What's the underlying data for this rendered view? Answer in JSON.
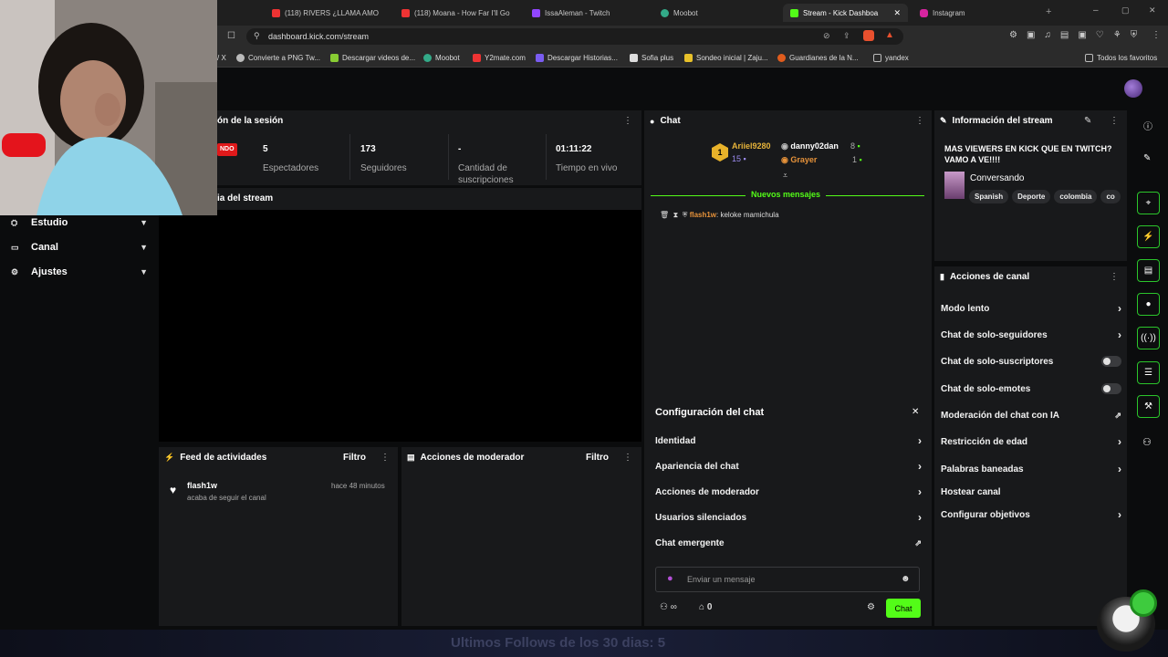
{
  "browser": {
    "tabs": [
      {
        "label": "(118) RIVERS ¿LLAMA AMO",
        "color": "#e33"
      },
      {
        "label": "(118) Moana - How Far I'll Go",
        "color": "#e33"
      },
      {
        "label": "IssaAleman - Twitch",
        "color": "#9146ff"
      },
      {
        "label": "Moobot",
        "color": "#3a8"
      },
      {
        "label": "Stream - Kick Dashboa",
        "color": "#53fc18"
      },
      {
        "label": "Instagram",
        "color": "#d6249f"
      }
    ],
    "url": "dashboard.kick.com/stream",
    "bookmarks": [
      {
        "label": "/ X",
        "color": "#999"
      },
      {
        "label": "Convierte a PNG Tw...",
        "color": "#bbb"
      },
      {
        "label": "Descargar videos de...",
        "color": "#8c3"
      },
      {
        "label": "Moobot",
        "color": "#3a8"
      },
      {
        "label": "Y2mate.com",
        "color": "#e33"
      },
      {
        "label": "Descargar Historias...",
        "color": "#7a5cf0"
      },
      {
        "label": "Sofia plus",
        "color": "#ddd"
      },
      {
        "label": "Sondeo inicial | Zaju...",
        "color": "#e8c12a"
      },
      {
        "label": "Guardianes de la N...",
        "color": "#e05c1d"
      },
      {
        "label": "yandex",
        "color": "#999"
      }
    ],
    "all_favorites": "Todos los favoritos"
  },
  "sidebar": {
    "items": [
      {
        "label": "Estudio",
        "icon": "studio-icon"
      },
      {
        "label": "Canal",
        "icon": "channel-icon"
      },
      {
        "label": "Ajustes",
        "icon": "settings-icon"
      }
    ]
  },
  "session": {
    "title": "ón de la sesión",
    "live_badge": "NDO",
    "stats": [
      {
        "value": "5",
        "label": "Espectadores"
      },
      {
        "value": "173",
        "label": "Seguidores"
      },
      {
        "value": "-",
        "label": "Cantidad de suscripciones"
      },
      {
        "value": "01:11:22",
        "label": "Tiempo en vivo"
      }
    ]
  },
  "preview": {
    "title": "ia del stream"
  },
  "activity": {
    "title": "Feed de actividades",
    "filter": "Filtro",
    "items": [
      {
        "user": "flash1w",
        "text": "acaba de seguir el canal",
        "time": "hace 48 minutos"
      }
    ]
  },
  "modactions": {
    "title": "Acciones de moderador",
    "filter": "Filtro"
  },
  "chat": {
    "title": "Chat",
    "top_gifters": [
      {
        "name": "Ariiel9280",
        "count": "15"
      },
      {
        "name": "danny02dan",
        "count": "8"
      },
      {
        "name": "Grayer",
        "count": "1"
      }
    ],
    "new_messages": "Nuevos mensajes",
    "messages": [
      {
        "user": "flash1w",
        "text": "keloke mamichula"
      }
    ],
    "settings": {
      "title": "Configuración del chat",
      "items": [
        "Identidad",
        "Apariencia del chat",
        "Acciones de moderador",
        "Usuarios silenciados",
        "Chat emergente"
      ]
    },
    "input_placeholder": "Enviar un mensaje",
    "points": "0",
    "send_label": "Chat"
  },
  "stream_info": {
    "title": "Información del stream",
    "stream_title": "MAS VIEWERS EN KICK QUE EN TWITCH? VAMO A VE!!!!",
    "category": "Conversando",
    "tags": [
      "Spanish",
      "Deporte",
      "colombia",
      "co"
    ]
  },
  "channel_actions": {
    "title": "Acciones de canal",
    "items": [
      {
        "label": "Modo lento",
        "control": "arrow"
      },
      {
        "label": "Chat de solo-seguidores",
        "control": "arrow"
      },
      {
        "label": "Chat de solo-suscriptores",
        "control": "toggle"
      },
      {
        "label": "Chat de solo-emotes",
        "control": "toggle"
      },
      {
        "label": "Moderación del chat con IA",
        "control": "external"
      },
      {
        "label": "Restricción de edad",
        "control": "arrow"
      },
      {
        "label": "Palabras baneadas",
        "control": "arrow"
      },
      {
        "label": "Hostear canal",
        "control": "none"
      },
      {
        "label": "Configurar objetivos",
        "control": "arrow"
      }
    ]
  },
  "overlay": {
    "follows_text": "Ultimos Follows de los 30 dias: 5"
  },
  "colors": {
    "accent": "#53fc18",
    "live": "#e0191b",
    "panel": "#18191b"
  }
}
